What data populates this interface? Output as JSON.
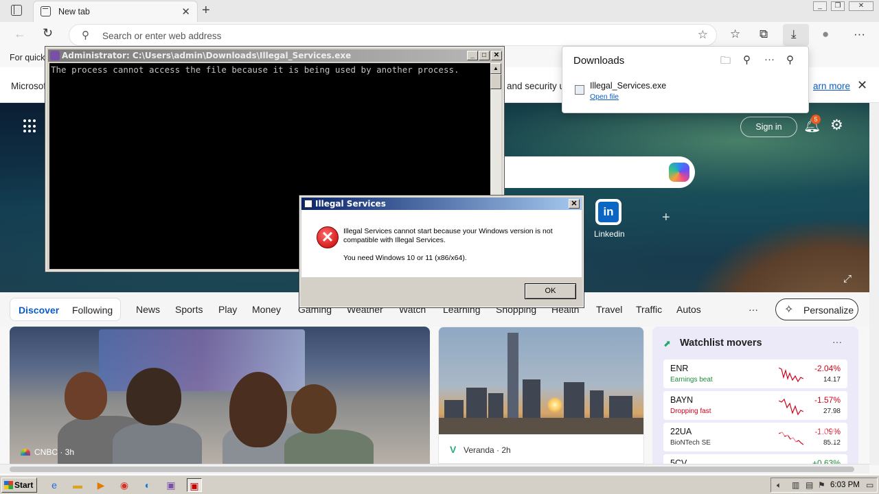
{
  "browser": {
    "tab_title": "New tab",
    "address_placeholder": "Search or enter web address",
    "favbar_text": "For quick"
  },
  "infobar": {
    "left_text": "Microsof",
    "mid_text": "and security u",
    "link_text": "arn more"
  },
  "hero": {
    "signin_label": "Sign in",
    "notification_count": "5",
    "tile_linkedin_label": "Linkedin",
    "tile_linkedin_glyph": "in"
  },
  "feed_nav": {
    "discover": "Discover",
    "following": "Following",
    "items": [
      "News",
      "Sports",
      "Play",
      "Money",
      "Gaming",
      "Weather",
      "Watch",
      "Learning",
      "Shopping",
      "Health",
      "Travel",
      "Traffic",
      "Autos"
    ],
    "more": "···",
    "personalize": "Personalize"
  },
  "cards": {
    "main_source": "CNBC · 3h",
    "city_source": "Veranda · 2h",
    "watchlist": {
      "title": "Watchlist movers",
      "stocks": [
        {
          "symbol": "ENR",
          "sub": "Earnings beat",
          "pct": "-2.04%",
          "price": "14.17",
          "sub_color": "#1e8a3c"
        },
        {
          "symbol": "BAYN",
          "sub": "Dropping fast",
          "pct": "-1.57%",
          "price": "27.98",
          "sub_color": "#d0021b"
        },
        {
          "symbol": "22UA",
          "sub": "BioNTech SE",
          "pct": "-1.09%",
          "price": "85.12",
          "sub_color": "#333333"
        },
        {
          "symbol": "5CV",
          "sub": "",
          "pct": "+0.63%",
          "price": "",
          "sub_color": "#333333"
        }
      ]
    }
  },
  "downloads": {
    "title": "Downloads",
    "file_name": "Illegal_Services.exe",
    "open_link": "Open file"
  },
  "console": {
    "title": "Administrator: C:\\Users\\admin\\Downloads\\Illegal_Services.exe",
    "output": "The process cannot access the file because it is being used by another process."
  },
  "dialog": {
    "title": "Illegal Services",
    "message": "Illegal Services cannot start because your Windows version is not compatible with Illegal Services.",
    "message2": "You need Windows 10 or 11 (x86/x64).",
    "ok_label": "OK"
  },
  "taskbar": {
    "start_label": "Start",
    "clock": "6:03 PM"
  },
  "watermark": "ANY RUN"
}
